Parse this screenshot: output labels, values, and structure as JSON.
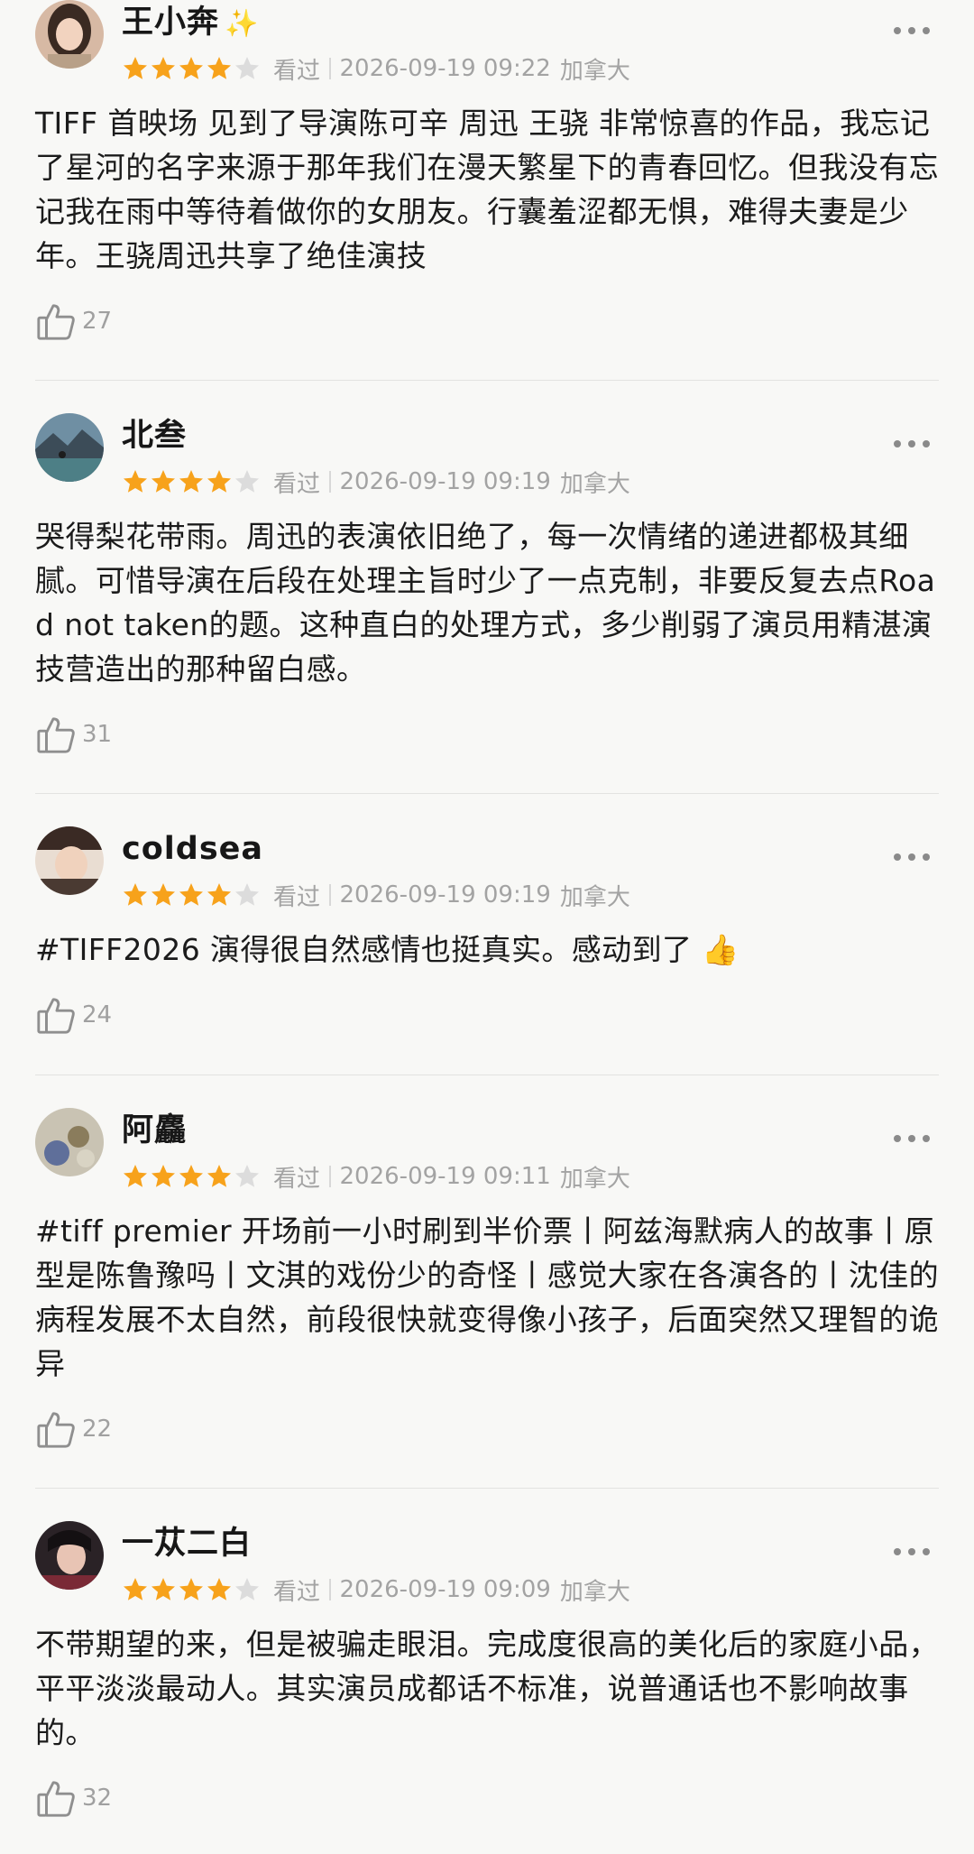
{
  "reviews": [
    {
      "name": "王小奔",
      "name_emoji": "✨",
      "rating": 4,
      "status": "看过",
      "time": "2026-09-19 09:22",
      "location": "加拿大",
      "text": "TIFF 首映场 见到了导演陈可辛 周迅 王骁 非常惊喜的作品，我忘记了星河的名字来源于那年我们在漫天繁星下的青春回忆。但我没有忘记我在雨中等待着做你的女朋友。行囊羞涩都无惧，难得夫妻是少年。王骁周迅共享了绝佳演技",
      "likes": "27"
    },
    {
      "name": "北叁",
      "name_emoji": "",
      "rating": 4,
      "status": "看过",
      "time": "2026-09-19 09:19",
      "location": "加拿大",
      "text": "哭得梨花带雨。周迅的表演依旧绝了，每一次情绪的递进都极其细腻。可惜导演在后段在处理主旨时少了一点克制，非要反复去点Road not taken的题。这种直白的处理方式，多少削弱了演员用精湛演技营造出的那种留白感。",
      "likes": "31"
    },
    {
      "name": "coldsea",
      "name_emoji": "",
      "rating": 4,
      "status": "看过",
      "time": "2026-09-19 09:19",
      "location": "加拿大",
      "text": "#TIFF2026 演得很自然感情也挺真实。感动到了 👍",
      "likes": "24"
    },
    {
      "name": "阿麤",
      "name_emoji": "",
      "rating": 4,
      "status": "看过",
      "time": "2026-09-19 09:11",
      "location": "加拿大",
      "text": "#tiff premier 开场前一小时刷到半价票丨阿兹海默病人的故事丨原型是陈鲁豫吗丨文淇的戏份少的奇怪丨感觉大家在各演各的丨沈佳的病程发展不太自然，前段很快就变得像小孩子，后面突然又理智的诡异",
      "likes": "22"
    },
    {
      "name": "一苁二白",
      "name_emoji": "",
      "rating": 4,
      "status": "看过",
      "time": "2026-09-19 09:09",
      "location": "加拿大",
      "text": "不带期望的来，但是被骗走眼泪。完成度很高的美化后的家庭小品，平平淡淡最动人。其实演员成都话不标准，说普通话也不影响故事的。",
      "likes": "32"
    }
  ],
  "colors": {
    "star_filled": "#f7a21b",
    "star_empty": "#dcdcdc",
    "meta_text": "#a3a3a3",
    "divider": "#e3e3e1"
  },
  "icons": [
    "more-icon",
    "like-icon",
    "star-icon"
  ]
}
